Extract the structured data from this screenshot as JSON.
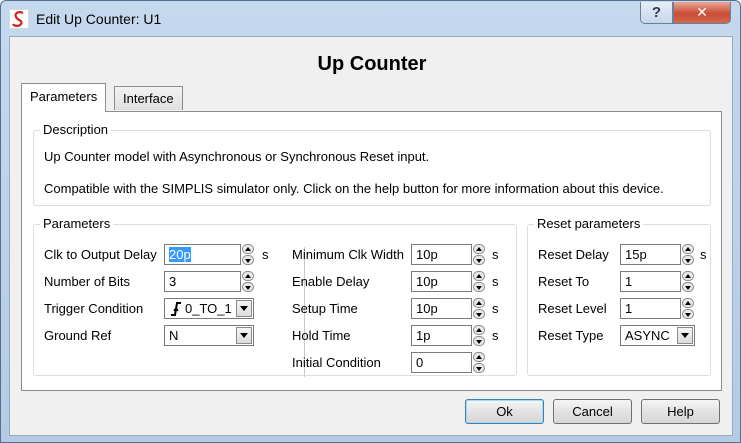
{
  "window": {
    "title": "Edit Up Counter: U1",
    "help_label": "?",
    "close_label": "✕"
  },
  "heading": "Up Counter",
  "tabs": [
    {
      "label": "Parameters",
      "active": true
    },
    {
      "label": "Interface",
      "active": false
    }
  ],
  "description": {
    "title": "Description",
    "line1": "Up Counter model with Asynchronous or Synchronous Reset input.",
    "line2": "Compatible with the SIMPLIS simulator only. Click on the help button for more information about this device."
  },
  "parameters": {
    "title": "Parameters",
    "clk_to_output_delay": {
      "label": "Clk to Output Delay",
      "value": "20p",
      "unit": "s"
    },
    "number_of_bits": {
      "label": "Number of Bits",
      "value": "3"
    },
    "trigger_condition": {
      "label": "Trigger Condition",
      "value": "0_TO_1",
      "icon": "rising-edge-icon"
    },
    "ground_ref": {
      "label": "Ground Ref",
      "value": "N"
    },
    "minimum_clk_width": {
      "label": "Minimum Clk Width",
      "value": "10p",
      "unit": "s"
    },
    "enable_delay": {
      "label": "Enable Delay",
      "value": "10p",
      "unit": "s"
    },
    "setup_time": {
      "label": "Setup Time",
      "value": "10p",
      "unit": "s"
    },
    "hold_time": {
      "label": "Hold Time",
      "value": "1p",
      "unit": "s"
    },
    "initial_condition": {
      "label": "Initial Condition",
      "value": "0"
    }
  },
  "reset": {
    "title": "Reset parameters",
    "reset_delay": {
      "label": "Reset Delay",
      "value": "15p",
      "unit": "s"
    },
    "reset_to": {
      "label": "Reset To",
      "value": "1"
    },
    "reset_level": {
      "label": "Reset Level",
      "value": "1"
    },
    "reset_type": {
      "label": "Reset Type",
      "value": "ASYNC"
    }
  },
  "buttons": {
    "ok": "Ok",
    "cancel": "Cancel",
    "help": "Help"
  },
  "colors": {
    "accent_selection": "#3399ff",
    "close_button": "#c84c34",
    "title_bar": "#c4d9ee"
  }
}
